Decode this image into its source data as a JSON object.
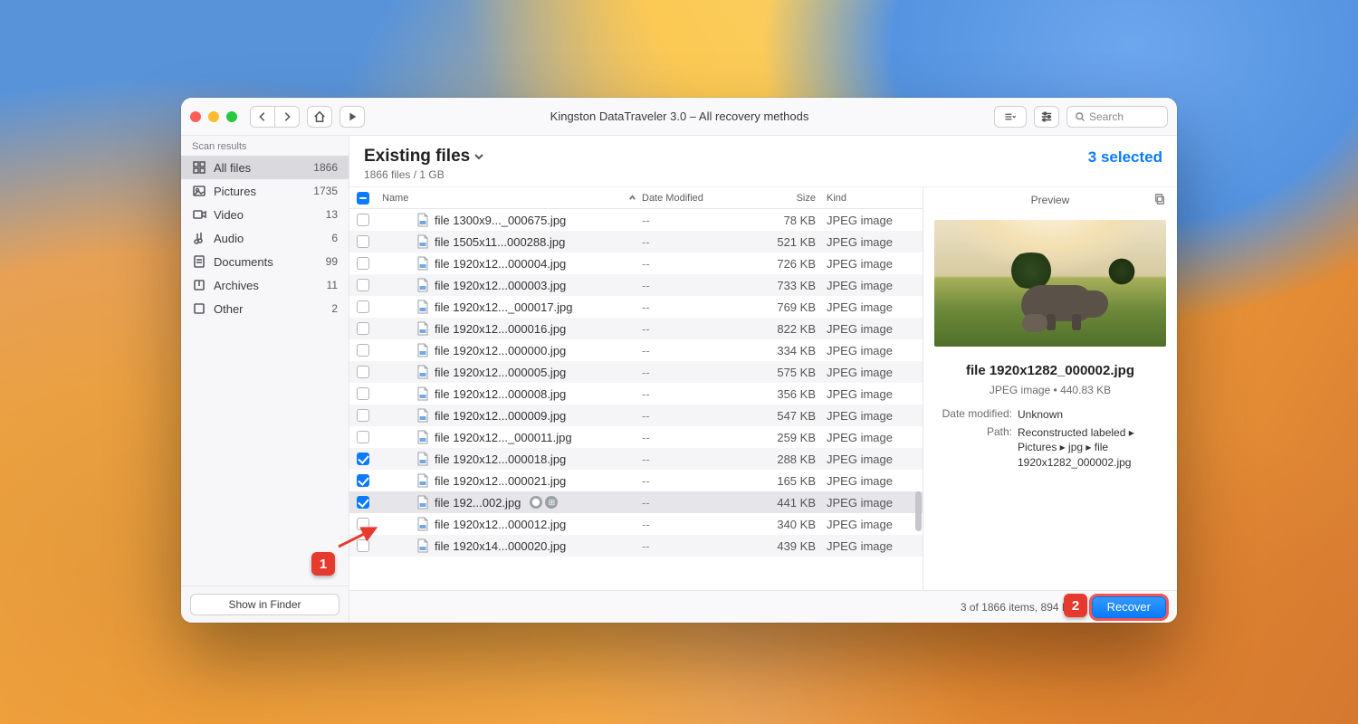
{
  "window_title": "Kingston DataTraveler 3.0 – All recovery methods",
  "search_placeholder": "Search",
  "sidebar": {
    "header": "Scan results",
    "items": [
      {
        "label": "All files",
        "count": "1866",
        "icon": "grid"
      },
      {
        "label": "Pictures",
        "count": "1735",
        "icon": "picture"
      },
      {
        "label": "Video",
        "count": "13",
        "icon": "video"
      },
      {
        "label": "Audio",
        "count": "6",
        "icon": "audio"
      },
      {
        "label": "Documents",
        "count": "99",
        "icon": "document"
      },
      {
        "label": "Archives",
        "count": "11",
        "icon": "archive"
      },
      {
        "label": "Other",
        "count": "2",
        "icon": "other"
      }
    ],
    "show_in_finder": "Show in Finder"
  },
  "main_header": {
    "title": "Existing files",
    "subtitle": "1866 files / 1 GB",
    "selected_label": "3 selected"
  },
  "columns": {
    "name": "Name",
    "date": "Date Modified",
    "size": "Size",
    "kind": "Kind"
  },
  "rows": [
    {
      "checked": false,
      "name": "file 1300x9..._000675.jpg",
      "date": "--",
      "size": "78 KB",
      "kind": "JPEG image"
    },
    {
      "checked": false,
      "name": "file 1505x11...000288.jpg",
      "date": "--",
      "size": "521 KB",
      "kind": "JPEG image"
    },
    {
      "checked": false,
      "name": "file 1920x12...000004.jpg",
      "date": "--",
      "size": "726 KB",
      "kind": "JPEG image"
    },
    {
      "checked": false,
      "name": "file 1920x12...000003.jpg",
      "date": "--",
      "size": "733 KB",
      "kind": "JPEG image"
    },
    {
      "checked": false,
      "name": "file 1920x12..._000017.jpg",
      "date": "--",
      "size": "769 KB",
      "kind": "JPEG image"
    },
    {
      "checked": false,
      "name": "file 1920x12...000016.jpg",
      "date": "--",
      "size": "822 KB",
      "kind": "JPEG image"
    },
    {
      "checked": false,
      "name": "file 1920x12...000000.jpg",
      "date": "--",
      "size": "334 KB",
      "kind": "JPEG image"
    },
    {
      "checked": false,
      "name": "file 1920x12...000005.jpg",
      "date": "--",
      "size": "575 KB",
      "kind": "JPEG image"
    },
    {
      "checked": false,
      "name": "file 1920x12...000008.jpg",
      "date": "--",
      "size": "356 KB",
      "kind": "JPEG image"
    },
    {
      "checked": false,
      "name": "file 1920x12...000009.jpg",
      "date": "--",
      "size": "547 KB",
      "kind": "JPEG image"
    },
    {
      "checked": false,
      "name": "file 1920x12..._000011.jpg",
      "date": "--",
      "size": "259 KB",
      "kind": "JPEG image"
    },
    {
      "checked": true,
      "name": "file 1920x12...000018.jpg",
      "date": "--",
      "size": "288 KB",
      "kind": "JPEG image"
    },
    {
      "checked": true,
      "name": "file 1920x12...000021.jpg",
      "date": "--",
      "size": "165 KB",
      "kind": "JPEG image"
    },
    {
      "checked": true,
      "name": "file 192...002.jpg",
      "date": "--",
      "size": "441 KB",
      "kind": "JPEG image",
      "selected": true,
      "badges": true
    },
    {
      "checked": false,
      "name": "file 1920x12...000012.jpg",
      "date": "--",
      "size": "340 KB",
      "kind": "JPEG image"
    },
    {
      "checked": false,
      "name": "file 1920x14...000020.jpg",
      "date": "--",
      "size": "439 KB",
      "kind": "JPEG image"
    }
  ],
  "preview": {
    "header": "Preview",
    "filename": "file 1920x1282_000002.jpg",
    "meta": "JPEG image • 440.83 KB",
    "date_label": "Date modified:",
    "date_value": "Unknown",
    "path_label": "Path:",
    "path_value": "Reconstructed labeled ▸ Pictures ▸ jpg ▸ file 1920x1282_000002.jpg"
  },
  "footer": {
    "status": "3 of 1866 items, 894 KB t",
    "recover": "Recover"
  },
  "callouts": {
    "one": "1",
    "two": "2"
  }
}
